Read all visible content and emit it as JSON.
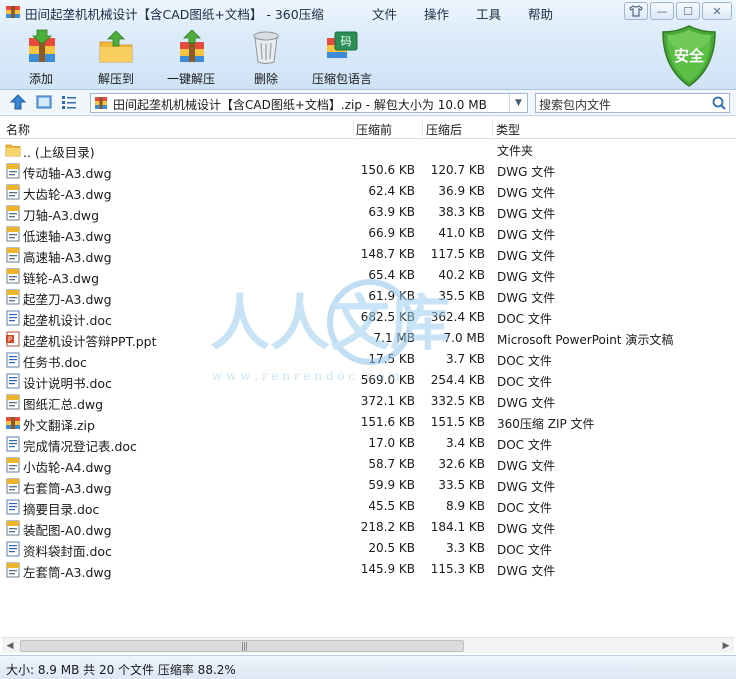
{
  "window": {
    "title": "田间起垄机机械设计【含CAD图纸+文档】 - 360压缩"
  },
  "menu": [
    {
      "label": "文件"
    },
    {
      "label": "操作"
    },
    {
      "label": "工具"
    },
    {
      "label": "帮助"
    }
  ],
  "toolbar": {
    "add_label": "添加",
    "extract_label": "解压到",
    "oneclick_label": "一键解压",
    "delete_label": "删除",
    "language_label": "压缩包语言",
    "language_badge": "码",
    "security_label": "安全"
  },
  "address": {
    "path": "田间起垄机机械设计【含CAD图纸+文档】.zip - 解包大小为 10.0 MB"
  },
  "search": {
    "placeholder": "搜索包内文件"
  },
  "columns": {
    "name": "名称",
    "compressed": "压缩前",
    "uncompressed": "压缩后",
    "type": "类型"
  },
  "files": [
    {
      "name": ".. (上级目录)",
      "before": "",
      "after": "",
      "type": "文件夹",
      "icon": "folder-icon"
    },
    {
      "name": "传动轴-A3.dwg",
      "before": "150.6 KB",
      "after": "120.7 KB",
      "type": "DWG 文件",
      "icon": "dwg-file-icon"
    },
    {
      "name": "大齿轮-A3.dwg",
      "before": "62.4 KB",
      "after": "36.9 KB",
      "type": "DWG 文件",
      "icon": "dwg-file-icon"
    },
    {
      "name": "刀轴-A3.dwg",
      "before": "63.9 KB",
      "after": "38.3 KB",
      "type": "DWG 文件",
      "icon": "dwg-file-icon"
    },
    {
      "name": "低速轴-A3.dwg",
      "before": "66.9 KB",
      "after": "41.0 KB",
      "type": "DWG 文件",
      "icon": "dwg-file-icon"
    },
    {
      "name": "高速轴-A3.dwg",
      "before": "148.7 KB",
      "after": "117.5 KB",
      "type": "DWG 文件",
      "icon": "dwg-file-icon"
    },
    {
      "name": "链轮-A3.dwg",
      "before": "65.4 KB",
      "after": "40.2 KB",
      "type": "DWG 文件",
      "icon": "dwg-file-icon"
    },
    {
      "name": "起垄刀-A3.dwg",
      "before": "61.9 KB",
      "after": "35.5 KB",
      "type": "DWG 文件",
      "icon": "dwg-file-icon"
    },
    {
      "name": "起垄机设计.doc",
      "before": "682.5 KB",
      "after": "362.4 KB",
      "type": "DOC 文件",
      "icon": "doc-file-icon"
    },
    {
      "name": "起垄机设计答辩PPT.ppt",
      "before": "7.1 MB",
      "after": "7.0 MB",
      "type": "Microsoft PowerPoint 演示文稿",
      "icon": "ppt-file-icon"
    },
    {
      "name": "任务书.doc",
      "before": "17.5 KB",
      "after": "3.7 KB",
      "type": "DOC 文件",
      "icon": "doc-file-icon"
    },
    {
      "name": "设计说明书.doc",
      "before": "569.0 KB",
      "after": "254.4 KB",
      "type": "DOC 文件",
      "icon": "doc-file-icon"
    },
    {
      "name": "图纸汇总.dwg",
      "before": "372.1 KB",
      "after": "332.5 KB",
      "type": "DWG 文件",
      "icon": "dwg-file-icon"
    },
    {
      "name": "外文翻译.zip",
      "before": "151.6 KB",
      "after": "151.5 KB",
      "type": "360压缩 ZIP 文件",
      "icon": "zip-file-icon"
    },
    {
      "name": "完成情况登记表.doc",
      "before": "17.0 KB",
      "after": "3.4 KB",
      "type": "DOC 文件",
      "icon": "doc-file-icon"
    },
    {
      "name": "小齿轮-A4.dwg",
      "before": "58.7 KB",
      "after": "32.6 KB",
      "type": "DWG 文件",
      "icon": "dwg-file-icon"
    },
    {
      "name": "右套筒-A3.dwg",
      "before": "59.9 KB",
      "after": "33.5 KB",
      "type": "DWG 文件",
      "icon": "dwg-file-icon"
    },
    {
      "name": "摘要目录.doc",
      "before": "45.5 KB",
      "after": "8.9 KB",
      "type": "DOC 文件",
      "icon": "doc-file-icon"
    },
    {
      "name": "装配图-A0.dwg",
      "before": "218.2 KB",
      "after": "184.1 KB",
      "type": "DWG 文件",
      "icon": "dwg-file-icon"
    },
    {
      "name": "资料袋封面.doc",
      "before": "20.5 KB",
      "after": "3.3 KB",
      "type": "DOC 文件",
      "icon": "doc-file-icon"
    },
    {
      "name": "左套筒-A3.dwg",
      "before": "145.9 KB",
      "after": "115.3 KB",
      "type": "DWG 文件",
      "icon": "dwg-file-icon"
    }
  ],
  "watermark": {
    "text": "人人文库",
    "url": "w w w . r e n r e n d o c . c o m"
  },
  "status": {
    "text": "大小: 8.9 MB 共 20 个文件 压缩率 88.2%"
  },
  "colors": {
    "accent": "#2f7fd0",
    "shield": "#3e9a2e"
  }
}
